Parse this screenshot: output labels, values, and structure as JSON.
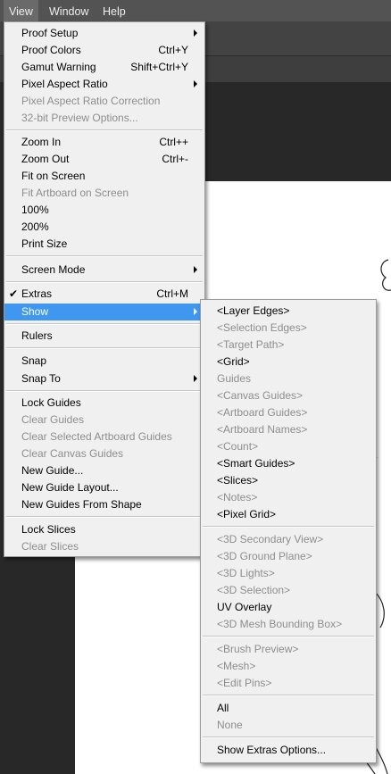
{
  "menubar": {
    "view": "View",
    "window": "Window",
    "help": "Help"
  },
  "view_menu": {
    "proof_setup": "Proof Setup",
    "proof_colors": "Proof Colors",
    "proof_colors_sc": "Ctrl+Y",
    "gamut_warning": "Gamut Warning",
    "gamut_warning_sc": "Shift+Ctrl+Y",
    "pixel_aspect_ratio": "Pixel Aspect Ratio",
    "pixel_aspect_ratio_correction": "Pixel Aspect Ratio Correction",
    "preview_options_32bit": "32-bit Preview Options...",
    "zoom_in": "Zoom In",
    "zoom_in_sc": "Ctrl++",
    "zoom_out": "Zoom Out",
    "zoom_out_sc": "Ctrl+-",
    "fit_on_screen": "Fit on Screen",
    "fit_artboard_on_screen": "Fit Artboard on Screen",
    "zoom_100": "100%",
    "zoom_200": "200%",
    "print_size": "Print Size",
    "screen_mode": "Screen Mode",
    "extras": "Extras",
    "extras_sc": "Ctrl+M",
    "show": "Show",
    "rulers": "Rulers",
    "snap": "Snap",
    "snap_to": "Snap To",
    "lock_guides": "Lock Guides",
    "clear_guides": "Clear Guides",
    "clear_selected_artboard_guides": "Clear Selected Artboard Guides",
    "clear_canvas_guides": "Clear Canvas Guides",
    "new_guide": "New Guide...",
    "new_guide_layout": "New Guide Layout...",
    "new_guides_from_shape": "New Guides From Shape",
    "lock_slices": "Lock Slices",
    "clear_slices": "Clear Slices"
  },
  "show_submenu": {
    "layer_edges": "<Layer Edges>",
    "selection_edges": "<Selection Edges>",
    "target_path": "<Target Path>",
    "grid": "<Grid>",
    "guides": "Guides",
    "canvas_guides": "<Canvas Guides>",
    "artboard_guides": "<Artboard Guides>",
    "artboard_names": "<Artboard Names>",
    "count": "<Count>",
    "smart_guides": "<Smart Guides>",
    "slices": "<Slices>",
    "notes": "<Notes>",
    "pixel_grid": "<Pixel Grid>",
    "secondary_view_3d": "<3D Secondary View>",
    "ground_plane_3d": "<3D Ground Plane>",
    "lights_3d": "<3D Lights>",
    "selection_3d": "<3D Selection>",
    "uv_overlay": "UV Overlay",
    "mesh_bounding_box_3d": "<3D Mesh Bounding Box>",
    "brush_preview": "<Brush Preview>",
    "mesh": "<Mesh>",
    "edit_pins": "<Edit Pins>",
    "all": "All",
    "none": "None",
    "show_extras_options": "Show Extras Options..."
  },
  "colors": {
    "highlight": "#3f97f0",
    "menu_bg": "#f0f0f0",
    "disabled_text": "#8d8d8d",
    "menubar_bg": "#535353"
  }
}
